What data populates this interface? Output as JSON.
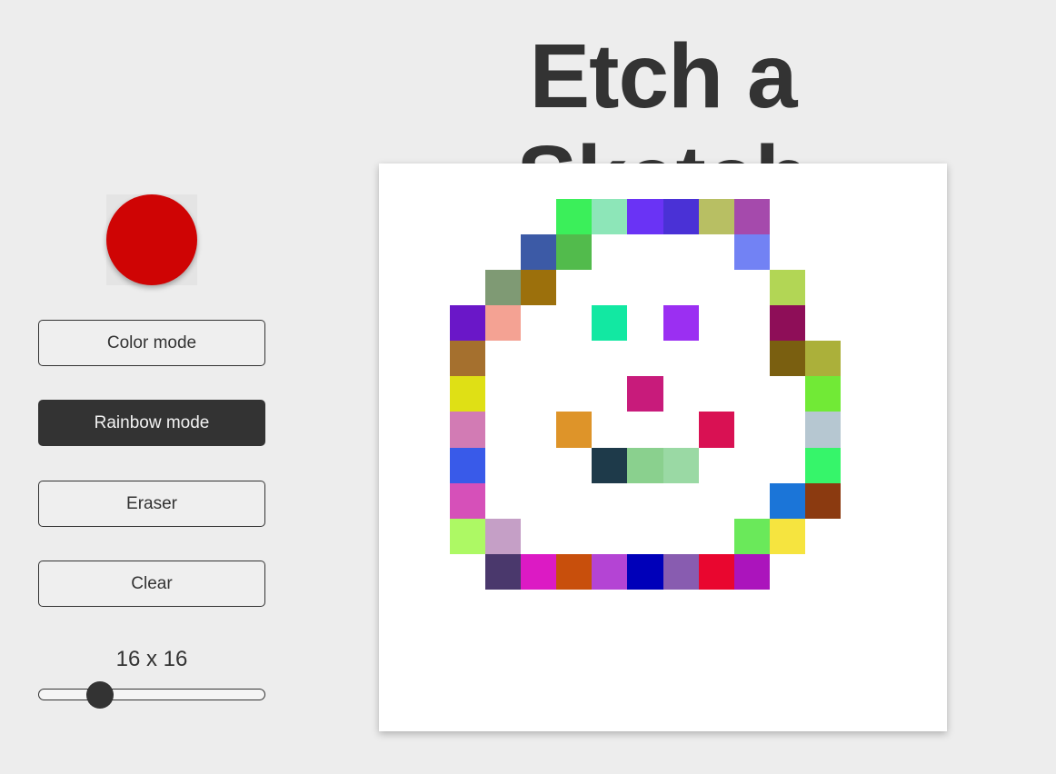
{
  "title": "Etch a Sketch",
  "color_picker": {
    "value": "#cf0404"
  },
  "buttons": {
    "color_mode": "Color mode",
    "rainbow_mode": "Rainbow mode",
    "eraser": "Eraser",
    "clear": "Clear"
  },
  "active_mode": "rainbow_mode",
  "grid": {
    "size_label": "16 x 16",
    "size": 16,
    "slider_fraction": 0.27,
    "background": "#ffffff",
    "cells": [
      {
        "row": 1,
        "col": 5,
        "color": "#3bef5a"
      },
      {
        "row": 1,
        "col": 6,
        "color": "#8de6b8"
      },
      {
        "row": 1,
        "col": 7,
        "color": "#6a33f5"
      },
      {
        "row": 1,
        "col": 8,
        "color": "#4a31d6"
      },
      {
        "row": 1,
        "col": 9,
        "color": "#b8bf63"
      },
      {
        "row": 1,
        "col": 10,
        "color": "#a54aac"
      },
      {
        "row": 2,
        "col": 4,
        "color": "#3c5aa6"
      },
      {
        "row": 2,
        "col": 5,
        "color": "#52bb4c"
      },
      {
        "row": 2,
        "col": 10,
        "color": "#7282f4"
      },
      {
        "row": 3,
        "col": 3,
        "color": "#7f9a74"
      },
      {
        "row": 3,
        "col": 4,
        "color": "#9c700c"
      },
      {
        "row": 3,
        "col": 11,
        "color": "#b2d655"
      },
      {
        "row": 4,
        "col": 2,
        "color": "#6a17c8"
      },
      {
        "row": 4,
        "col": 3,
        "color": "#f4a293"
      },
      {
        "row": 4,
        "col": 6,
        "color": "#12e8a2"
      },
      {
        "row": 4,
        "col": 8,
        "color": "#9b2ff2"
      },
      {
        "row": 4,
        "col": 11,
        "color": "#8e0e58"
      },
      {
        "row": 5,
        "col": 2,
        "color": "#a5702e"
      },
      {
        "row": 5,
        "col": 11,
        "color": "#7a5f10"
      },
      {
        "row": 5,
        "col": 12,
        "color": "#abb03a"
      },
      {
        "row": 6,
        "col": 2,
        "color": "#dfe015"
      },
      {
        "row": 6,
        "col": 7,
        "color": "#c81b7b"
      },
      {
        "row": 6,
        "col": 12,
        "color": "#71ea36"
      },
      {
        "row": 7,
        "col": 2,
        "color": "#d27bb4"
      },
      {
        "row": 7,
        "col": 5,
        "color": "#de9429"
      },
      {
        "row": 7,
        "col": 9,
        "color": "#d91153"
      },
      {
        "row": 7,
        "col": 12,
        "color": "#b6c7d1"
      },
      {
        "row": 8,
        "col": 2,
        "color": "#395ae9"
      },
      {
        "row": 8,
        "col": 6,
        "color": "#1e3a4a"
      },
      {
        "row": 8,
        "col": 7,
        "color": "#8ad08e"
      },
      {
        "row": 8,
        "col": 8,
        "color": "#9ad9a4"
      },
      {
        "row": 8,
        "col": 12,
        "color": "#36f56a"
      },
      {
        "row": 9,
        "col": 2,
        "color": "#d650b9"
      },
      {
        "row": 9,
        "col": 11,
        "color": "#1b75d8"
      },
      {
        "row": 9,
        "col": 12,
        "color": "#8b3a10"
      },
      {
        "row": 10,
        "col": 2,
        "color": "#adf964"
      },
      {
        "row": 10,
        "col": 3,
        "color": "#c59fc6"
      },
      {
        "row": 10,
        "col": 10,
        "color": "#6ae95a"
      },
      {
        "row": 10,
        "col": 11,
        "color": "#f6e43f"
      },
      {
        "row": 11,
        "col": 3,
        "color": "#4a386c"
      },
      {
        "row": 11,
        "col": 4,
        "color": "#dc1ac4"
      },
      {
        "row": 11,
        "col": 5,
        "color": "#c84f0c"
      },
      {
        "row": 11,
        "col": 6,
        "color": "#b444d4"
      },
      {
        "row": 11,
        "col": 7,
        "color": "#0000b9"
      },
      {
        "row": 11,
        "col": 8,
        "color": "#885cb0"
      },
      {
        "row": 11,
        "col": 9,
        "color": "#e9062f"
      },
      {
        "row": 11,
        "col": 10,
        "color": "#ab14bc"
      }
    ]
  }
}
